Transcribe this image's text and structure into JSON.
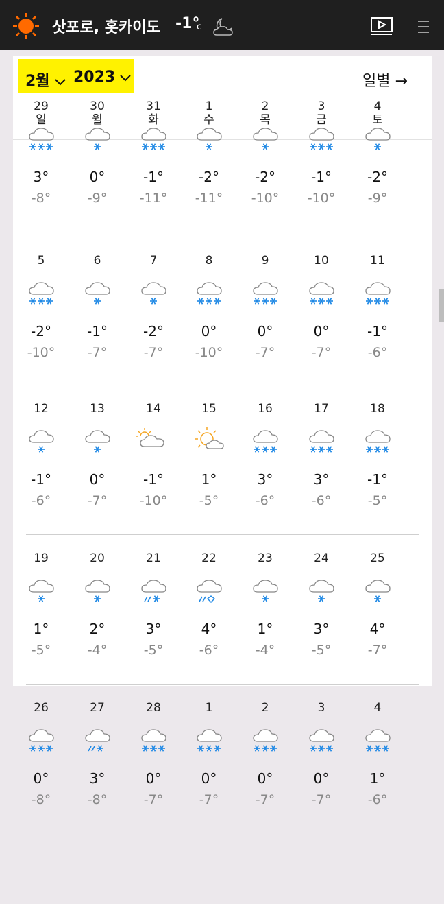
{
  "header": {
    "location": "삿포로, 홋카이도",
    "current_temp": "-1°",
    "unit": "c",
    "logo_icon": "sun-icon",
    "condition_icon": "moon-cloud-icon",
    "video_icon": "video-play-icon",
    "menu_icon": "hamburger-menu-icon"
  },
  "controls": {
    "month": "2월",
    "year": "2023",
    "daily_link": "일별 →",
    "highlight_color": "#fff200"
  },
  "weekdays": [
    "일",
    "월",
    "화",
    "수",
    "목",
    "금",
    "토"
  ],
  "colors": {
    "snow": "#1e88e5",
    "sun": "#f5a623",
    "low_temp": "#888888"
  },
  "weeks": [
    [
      {
        "date": "29",
        "icon": "heavy-snow",
        "hi": "3°",
        "lo": "-8°"
      },
      {
        "date": "30",
        "icon": "light-snow",
        "hi": "0°",
        "lo": "-9°"
      },
      {
        "date": "31",
        "icon": "heavy-snow",
        "hi": "-1°",
        "lo": "-11°"
      },
      {
        "date": "1",
        "icon": "light-snow",
        "hi": "-2°",
        "lo": "-11°"
      },
      {
        "date": "2",
        "icon": "light-snow",
        "hi": "-2°",
        "lo": "-10°"
      },
      {
        "date": "3",
        "icon": "heavy-snow",
        "hi": "-1°",
        "lo": "-10°"
      },
      {
        "date": "4",
        "icon": "light-snow",
        "hi": "-2°",
        "lo": "-9°"
      }
    ],
    [
      {
        "date": "5",
        "icon": "heavy-snow",
        "hi": "-2°",
        "lo": "-10°"
      },
      {
        "date": "6",
        "icon": "light-snow",
        "hi": "-1°",
        "lo": "-7°"
      },
      {
        "date": "7",
        "icon": "light-snow",
        "hi": "-2°",
        "lo": "-7°"
      },
      {
        "date": "8",
        "icon": "heavy-snow",
        "hi": "0°",
        "lo": "-10°"
      },
      {
        "date": "9",
        "icon": "heavy-snow",
        "hi": "0°",
        "lo": "-7°"
      },
      {
        "date": "10",
        "icon": "heavy-snow",
        "hi": "0°",
        "lo": "-7°"
      },
      {
        "date": "11",
        "icon": "heavy-snow",
        "hi": "-1°",
        "lo": "-6°"
      }
    ],
    [
      {
        "date": "12",
        "icon": "light-snow",
        "hi": "-1°",
        "lo": "-6°"
      },
      {
        "date": "13",
        "icon": "light-snow",
        "hi": "0°",
        "lo": "-7°"
      },
      {
        "date": "14",
        "icon": "mostly-cloudy",
        "hi": "-1°",
        "lo": "-10°"
      },
      {
        "date": "15",
        "icon": "partly-sunny",
        "hi": "1°",
        "lo": "-5°"
      },
      {
        "date": "16",
        "icon": "heavy-snow",
        "hi": "3°",
        "lo": "-6°"
      },
      {
        "date": "17",
        "icon": "heavy-snow",
        "hi": "3°",
        "lo": "-6°"
      },
      {
        "date": "18",
        "icon": "heavy-snow",
        "hi": "-1°",
        "lo": "-5°"
      }
    ],
    [
      {
        "date": "19",
        "icon": "light-snow",
        "hi": "1°",
        "lo": "-5°"
      },
      {
        "date": "20",
        "icon": "light-snow",
        "hi": "2°",
        "lo": "-4°"
      },
      {
        "date": "21",
        "icon": "rain-snow",
        "hi": "3°",
        "lo": "-5°"
      },
      {
        "date": "22",
        "icon": "rain-sleet",
        "hi": "4°",
        "lo": "-6°"
      },
      {
        "date": "23",
        "icon": "light-snow",
        "hi": "1°",
        "lo": "-4°"
      },
      {
        "date": "24",
        "icon": "light-snow",
        "hi": "3°",
        "lo": "-5°"
      },
      {
        "date": "25",
        "icon": "light-snow",
        "hi": "4°",
        "lo": "-7°"
      }
    ],
    [
      {
        "date": "26",
        "icon": "heavy-snow",
        "hi": "0°",
        "lo": "-8°"
      },
      {
        "date": "27",
        "icon": "rain-snow",
        "hi": "3°",
        "lo": "-8°"
      },
      {
        "date": "28",
        "icon": "heavy-snow",
        "hi": "0°",
        "lo": "-7°"
      },
      {
        "date": "1",
        "icon": "heavy-snow",
        "hi": "0°",
        "lo": "-7°"
      },
      {
        "date": "2",
        "icon": "heavy-snow",
        "hi": "0°",
        "lo": "-7°"
      },
      {
        "date": "3",
        "icon": "heavy-snow",
        "hi": "0°",
        "lo": "-7°"
      },
      {
        "date": "4",
        "icon": "heavy-snow",
        "hi": "1°",
        "lo": "-6°"
      }
    ]
  ]
}
